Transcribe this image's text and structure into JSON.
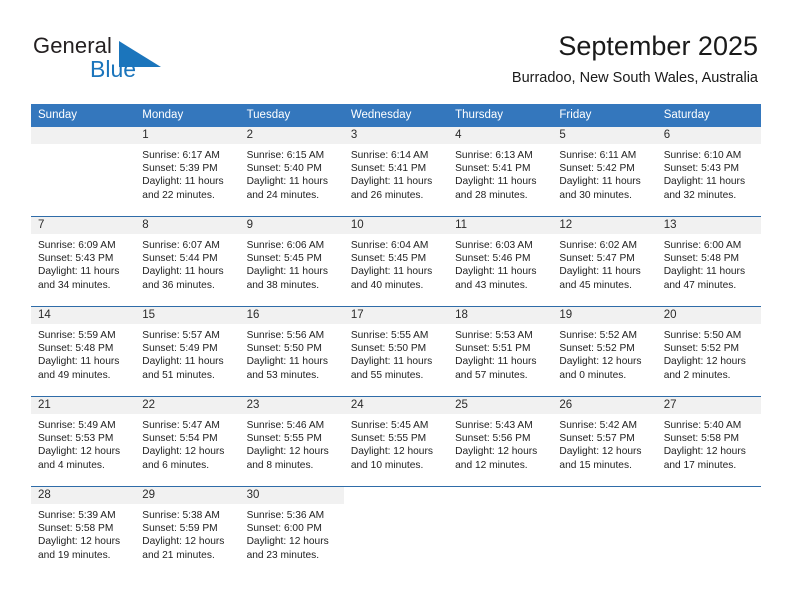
{
  "brand": {
    "name_part1": "General",
    "name_part2": "Blue",
    "accent_color": "#1b75bc",
    "triangle_color": "#1b75bc"
  },
  "header": {
    "title": "September 2025",
    "location": "Burradoo, New South Wales, Australia",
    "header_bg": "#3477bd",
    "band_bg": "#f1f1f1"
  },
  "calendar": {
    "weekday_headers": [
      "Sunday",
      "Monday",
      "Tuesday",
      "Wednesday",
      "Thursday",
      "Friday",
      "Saturday"
    ],
    "weeks": [
      [
        {
          "day": "",
          "sunrise": "",
          "sunset": "",
          "daylight_line1": "",
          "daylight_line2": "",
          "empty": true
        },
        {
          "day": "1",
          "sunrise": "Sunrise: 6:17 AM",
          "sunset": "Sunset: 5:39 PM",
          "daylight_line1": "Daylight: 11 hours",
          "daylight_line2": "and 22 minutes."
        },
        {
          "day": "2",
          "sunrise": "Sunrise: 6:15 AM",
          "sunset": "Sunset: 5:40 PM",
          "daylight_line1": "Daylight: 11 hours",
          "daylight_line2": "and 24 minutes."
        },
        {
          "day": "3",
          "sunrise": "Sunrise: 6:14 AM",
          "sunset": "Sunset: 5:41 PM",
          "daylight_line1": "Daylight: 11 hours",
          "daylight_line2": "and 26 minutes."
        },
        {
          "day": "4",
          "sunrise": "Sunrise: 6:13 AM",
          "sunset": "Sunset: 5:41 PM",
          "daylight_line1": "Daylight: 11 hours",
          "daylight_line2": "and 28 minutes."
        },
        {
          "day": "5",
          "sunrise": "Sunrise: 6:11 AM",
          "sunset": "Sunset: 5:42 PM",
          "daylight_line1": "Daylight: 11 hours",
          "daylight_line2": "and 30 minutes."
        },
        {
          "day": "6",
          "sunrise": "Sunrise: 6:10 AM",
          "sunset": "Sunset: 5:43 PM",
          "daylight_line1": "Daylight: 11 hours",
          "daylight_line2": "and 32 minutes."
        }
      ],
      [
        {
          "day": "7",
          "sunrise": "Sunrise: 6:09 AM",
          "sunset": "Sunset: 5:43 PM",
          "daylight_line1": "Daylight: 11 hours",
          "daylight_line2": "and 34 minutes."
        },
        {
          "day": "8",
          "sunrise": "Sunrise: 6:07 AM",
          "sunset": "Sunset: 5:44 PM",
          "daylight_line1": "Daylight: 11 hours",
          "daylight_line2": "and 36 minutes."
        },
        {
          "day": "9",
          "sunrise": "Sunrise: 6:06 AM",
          "sunset": "Sunset: 5:45 PM",
          "daylight_line1": "Daylight: 11 hours",
          "daylight_line2": "and 38 minutes."
        },
        {
          "day": "10",
          "sunrise": "Sunrise: 6:04 AM",
          "sunset": "Sunset: 5:45 PM",
          "daylight_line1": "Daylight: 11 hours",
          "daylight_line2": "and 40 minutes."
        },
        {
          "day": "11",
          "sunrise": "Sunrise: 6:03 AM",
          "sunset": "Sunset: 5:46 PM",
          "daylight_line1": "Daylight: 11 hours",
          "daylight_line2": "and 43 minutes."
        },
        {
          "day": "12",
          "sunrise": "Sunrise: 6:02 AM",
          "sunset": "Sunset: 5:47 PM",
          "daylight_line1": "Daylight: 11 hours",
          "daylight_line2": "and 45 minutes."
        },
        {
          "day": "13",
          "sunrise": "Sunrise: 6:00 AM",
          "sunset": "Sunset: 5:48 PM",
          "daylight_line1": "Daylight: 11 hours",
          "daylight_line2": "and 47 minutes."
        }
      ],
      [
        {
          "day": "14",
          "sunrise": "Sunrise: 5:59 AM",
          "sunset": "Sunset: 5:48 PM",
          "daylight_line1": "Daylight: 11 hours",
          "daylight_line2": "and 49 minutes."
        },
        {
          "day": "15",
          "sunrise": "Sunrise: 5:57 AM",
          "sunset": "Sunset: 5:49 PM",
          "daylight_line1": "Daylight: 11 hours",
          "daylight_line2": "and 51 minutes."
        },
        {
          "day": "16",
          "sunrise": "Sunrise: 5:56 AM",
          "sunset": "Sunset: 5:50 PM",
          "daylight_line1": "Daylight: 11 hours",
          "daylight_line2": "and 53 minutes."
        },
        {
          "day": "17",
          "sunrise": "Sunrise: 5:55 AM",
          "sunset": "Sunset: 5:50 PM",
          "daylight_line1": "Daylight: 11 hours",
          "daylight_line2": "and 55 minutes."
        },
        {
          "day": "18",
          "sunrise": "Sunrise: 5:53 AM",
          "sunset": "Sunset: 5:51 PM",
          "daylight_line1": "Daylight: 11 hours",
          "daylight_line2": "and 57 minutes."
        },
        {
          "day": "19",
          "sunrise": "Sunrise: 5:52 AM",
          "sunset": "Sunset: 5:52 PM",
          "daylight_line1": "Daylight: 12 hours",
          "daylight_line2": "and 0 minutes."
        },
        {
          "day": "20",
          "sunrise": "Sunrise: 5:50 AM",
          "sunset": "Sunset: 5:52 PM",
          "daylight_line1": "Daylight: 12 hours",
          "daylight_line2": "and 2 minutes."
        }
      ],
      [
        {
          "day": "21",
          "sunrise": "Sunrise: 5:49 AM",
          "sunset": "Sunset: 5:53 PM",
          "daylight_line1": "Daylight: 12 hours",
          "daylight_line2": "and 4 minutes."
        },
        {
          "day": "22",
          "sunrise": "Sunrise: 5:47 AM",
          "sunset": "Sunset: 5:54 PM",
          "daylight_line1": "Daylight: 12 hours",
          "daylight_line2": "and 6 minutes."
        },
        {
          "day": "23",
          "sunrise": "Sunrise: 5:46 AM",
          "sunset": "Sunset: 5:55 PM",
          "daylight_line1": "Daylight: 12 hours",
          "daylight_line2": "and 8 minutes."
        },
        {
          "day": "24",
          "sunrise": "Sunrise: 5:45 AM",
          "sunset": "Sunset: 5:55 PM",
          "daylight_line1": "Daylight: 12 hours",
          "daylight_line2": "and 10 minutes."
        },
        {
          "day": "25",
          "sunrise": "Sunrise: 5:43 AM",
          "sunset": "Sunset: 5:56 PM",
          "daylight_line1": "Daylight: 12 hours",
          "daylight_line2": "and 12 minutes."
        },
        {
          "day": "26",
          "sunrise": "Sunrise: 5:42 AM",
          "sunset": "Sunset: 5:57 PM",
          "daylight_line1": "Daylight: 12 hours",
          "daylight_line2": "and 15 minutes."
        },
        {
          "day": "27",
          "sunrise": "Sunrise: 5:40 AM",
          "sunset": "Sunset: 5:58 PM",
          "daylight_line1": "Daylight: 12 hours",
          "daylight_line2": "and 17 minutes."
        }
      ],
      [
        {
          "day": "28",
          "sunrise": "Sunrise: 5:39 AM",
          "sunset": "Sunset: 5:58 PM",
          "daylight_line1": "Daylight: 12 hours",
          "daylight_line2": "and 19 minutes."
        },
        {
          "day": "29",
          "sunrise": "Sunrise: 5:38 AM",
          "sunset": "Sunset: 5:59 PM",
          "daylight_line1": "Daylight: 12 hours",
          "daylight_line2": "and 21 minutes."
        },
        {
          "day": "30",
          "sunrise": "Sunrise: 5:36 AM",
          "sunset": "Sunset: 6:00 PM",
          "daylight_line1": "Daylight: 12 hours",
          "daylight_line2": "and 23 minutes."
        },
        {
          "day": "",
          "sunrise": "",
          "sunset": "",
          "daylight_line1": "",
          "daylight_line2": "",
          "empty": true
        },
        {
          "day": "",
          "sunrise": "",
          "sunset": "",
          "daylight_line1": "",
          "daylight_line2": "",
          "empty": true
        },
        {
          "day": "",
          "sunrise": "",
          "sunset": "",
          "daylight_line1": "",
          "daylight_line2": "",
          "empty": true
        },
        {
          "day": "",
          "sunrise": "",
          "sunset": "",
          "daylight_line1": "",
          "daylight_line2": "",
          "empty": true
        }
      ]
    ]
  }
}
